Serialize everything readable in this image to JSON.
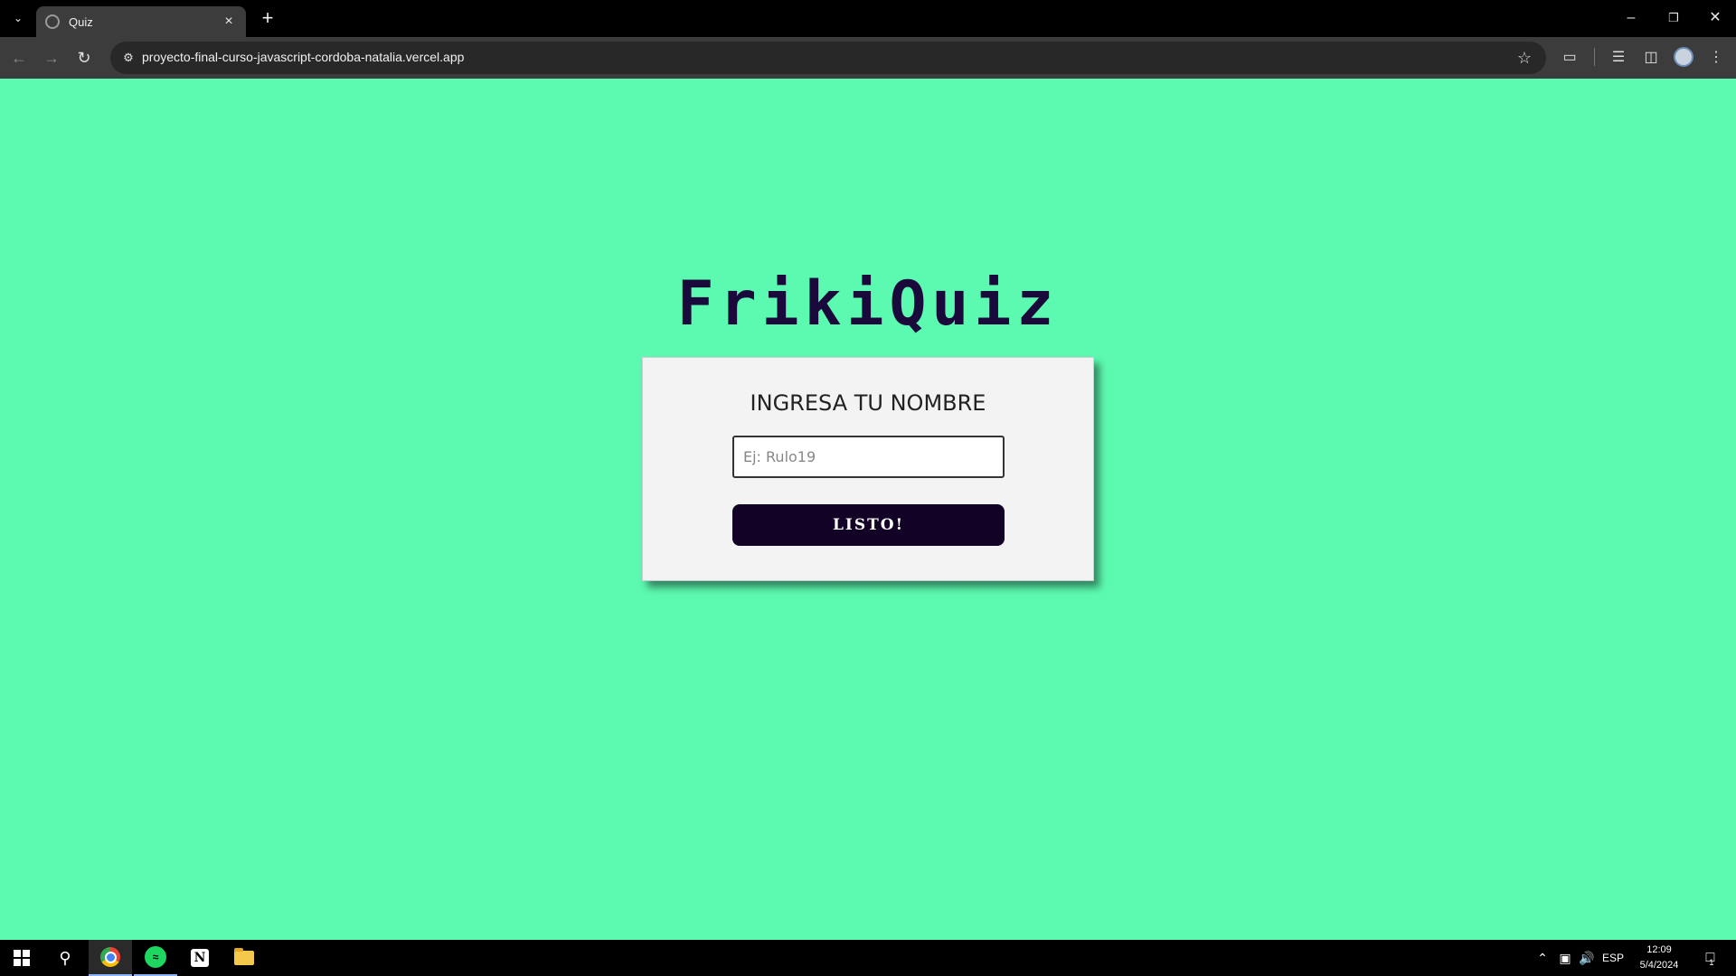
{
  "browser": {
    "tab_title": "Quiz",
    "new_tab_symbol": "+",
    "url": "proyecto-final-curso-javascript-cordoba-natalia.vercel.app",
    "icons": [
      "tab-search-icon",
      "favicon-icon",
      "tab-close-icon",
      "new-tab-icon",
      "back-icon",
      "forward-icon",
      "reload-icon",
      "site-info-icon",
      "bookmark-star-icon",
      "extensions-icon",
      "media-icon",
      "side-panel-icon",
      "profile-avatar",
      "more-menu-icon",
      "minimize-icon",
      "restore-icon",
      "close-window-icon"
    ]
  },
  "page": {
    "background_color": "#5cf9b0",
    "logo_text": "FrikiQuiz",
    "card_title": "INGRESA TU NOMBRE",
    "name_input": {
      "placeholder": "Ej: Rulo19",
      "value": ""
    },
    "submit_label": "LISTO!",
    "accent_color": "#120226"
  },
  "taskbar": {
    "apps": [
      "windows-start",
      "search",
      "chrome",
      "spotify",
      "notion",
      "file-explorer"
    ],
    "language": "ESP",
    "time": "12:09",
    "date": "5/4/2024",
    "notification_count": "1"
  }
}
